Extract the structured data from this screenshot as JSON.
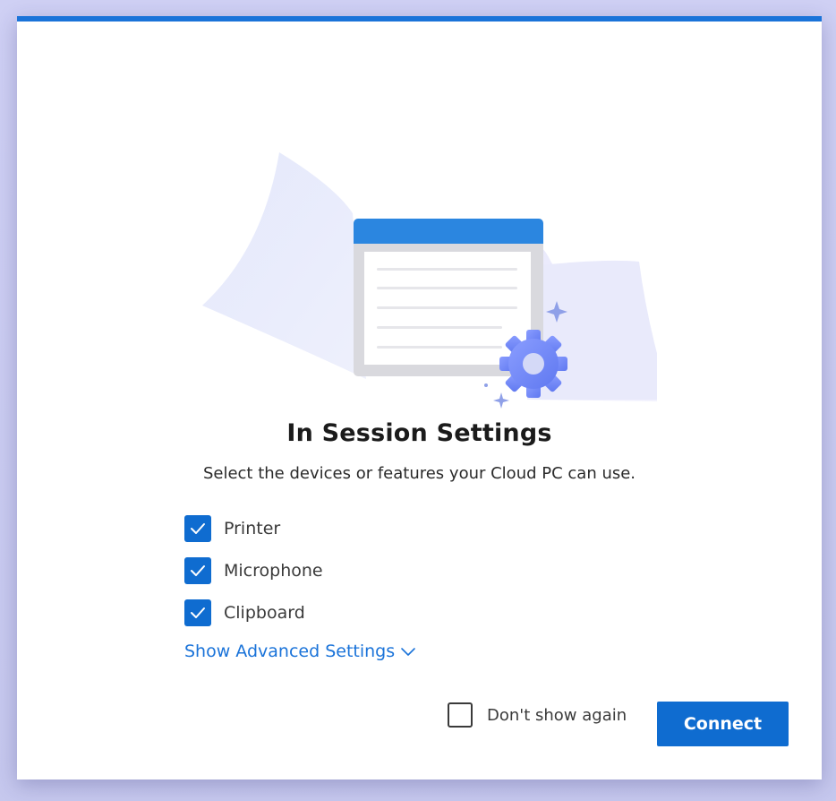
{
  "dialog": {
    "title": "In Session Settings",
    "subtitle": "Select the devices or features your Cloud PC can use.",
    "accent_color": "#1a73d9",
    "illustration_icons": [
      "window-icon",
      "gear-icon",
      "sparkle-icon"
    ]
  },
  "options": [
    {
      "label": "Printer",
      "checked": true,
      "icon": "checkmark-icon"
    },
    {
      "label": "Microphone",
      "checked": true,
      "icon": "checkmark-icon"
    },
    {
      "label": "Clipboard",
      "checked": true,
      "icon": "checkmark-icon"
    }
  ],
  "advanced": {
    "label": "Show Advanced Settings",
    "icon": "chevron-down-icon"
  },
  "footer": {
    "dont_show_label": "Don't show again",
    "dont_show_checked": false,
    "connect_label": "Connect",
    "button_color": "#0f6cd0"
  }
}
